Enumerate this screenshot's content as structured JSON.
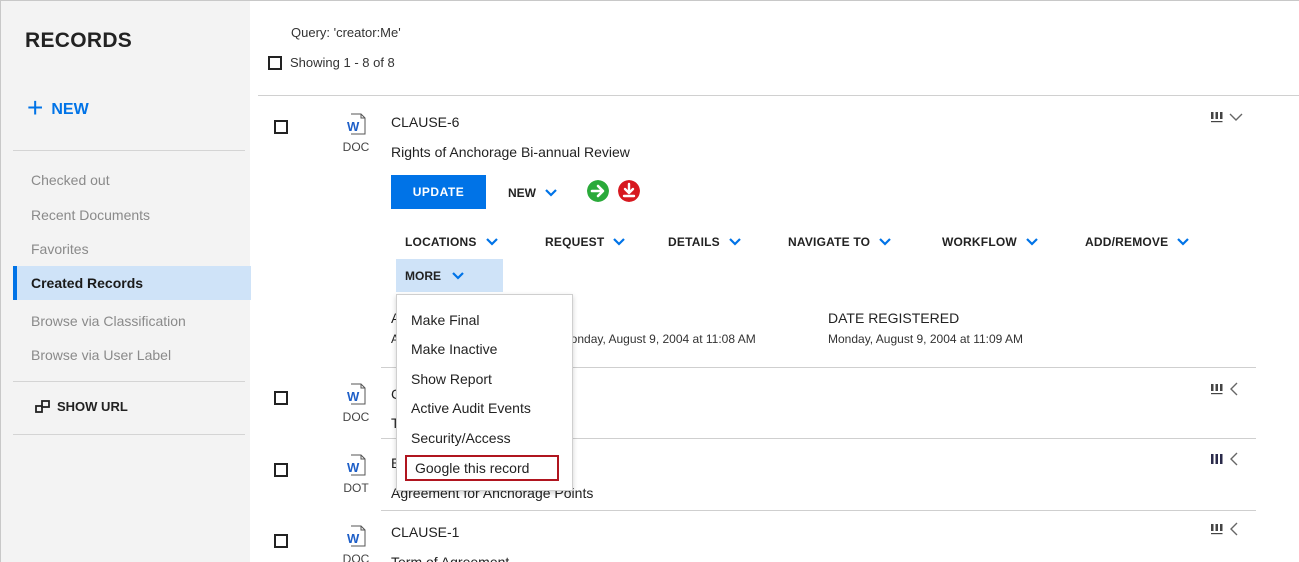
{
  "sidebar": {
    "title": "RECORDS",
    "new_label": "NEW",
    "items": [
      {
        "label": "Checked out",
        "active": false
      },
      {
        "label": "Recent Documents",
        "active": false
      },
      {
        "label": "Favorites",
        "active": false
      },
      {
        "label": "Created Records",
        "active": true
      },
      {
        "label": "Browse via Classification",
        "active": false
      },
      {
        "label": "Browse via User Label",
        "active": false
      }
    ],
    "show_url_label": "SHOW URL"
  },
  "main": {
    "query_text": "Query: 'creator:Me'",
    "showing_text": "Showing 1 - 8 of 8"
  },
  "records": [
    {
      "id": "CLAUSE-6",
      "title": "Rights of Anchorage Bi-annual Review",
      "type": "DOC",
      "expanded": true
    },
    {
      "id": "C",
      "title": "T",
      "type": "DOC",
      "expanded": false
    },
    {
      "id": "E",
      "title": "Agreement for Anchorage Points",
      "type": "DOT",
      "expanded": false
    },
    {
      "id": "CLAUSE-1",
      "title": "Term of Agreement",
      "type": "DOC",
      "expanded": false
    }
  ],
  "actions": {
    "update_label": "UPDATE",
    "new_label": "NEW",
    "menus": [
      "LOCATIONS",
      "REQUEST",
      "DETAILS",
      "NAVIGATE TO",
      "WORKFLOW",
      "ADD/REMOVE"
    ],
    "more_label": "MORE"
  },
  "meta": {
    "col1_label1": "A",
    "col1_label2": "A",
    "col1_value": "londay, August 9, 2004 at 11:08 AM",
    "date_registered_label": "DATE REGISTERED",
    "date_registered_value": "Monday, August 9, 2004 at 11:09 AM"
  },
  "more_menu": {
    "items": [
      "Make Final",
      "Make Inactive",
      "Show Report",
      "Active Audit Events",
      "Security/Access",
      "Google this record"
    ],
    "highlighted_index": 5
  },
  "colors": {
    "accent": "#0073e7",
    "sidebar_bg": "#f3f3f3",
    "active_item_bg": "#cfe3f8",
    "checkin_green": "#2aaa3a",
    "download_red": "#d71920",
    "highlight_border": "#b0151f"
  },
  "icons": {
    "new": "plus-icon",
    "show_url": "link-icon",
    "record": "word-document-icon",
    "columns": "columns-icon",
    "chevron": "chevron-down-icon",
    "checkin": "arrow-right-circle-icon",
    "download": "download-circle-icon"
  }
}
